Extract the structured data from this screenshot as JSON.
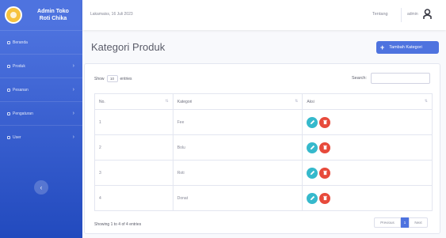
{
  "brand": {
    "line1": "Admin Toko",
    "line2": "Roti Chika"
  },
  "sidebar": {
    "items": [
      {
        "label": "Beranda",
        "has_chevron": false
      },
      {
        "label": "Produk",
        "has_chevron": true
      },
      {
        "label": "Pesanan",
        "has_chevron": true
      },
      {
        "label": "Pengaturan",
        "has_chevron": true
      },
      {
        "label": "User",
        "has_chevron": true
      }
    ],
    "toggle_icon": "chevron-left-icon"
  },
  "topbar": {
    "date": "Lakamaiss, 16 Juli 2023",
    "link": "Tentang",
    "user": "admin",
    "user_icon": "user-icon"
  },
  "page": {
    "title": "Kategori Produk",
    "add_button": "Tambah Kategori"
  },
  "table_controls": {
    "show_label": "Show",
    "entries_value": "10",
    "entries_label": "entries",
    "search_label": "Search:"
  },
  "table": {
    "headers": [
      "No.",
      "Kategori",
      "Aksi"
    ],
    "rows": [
      {
        "no": "1",
        "kategori": "Fee"
      },
      {
        "no": "2",
        "kategori": "Bolu"
      },
      {
        "no": "3",
        "kategori": "Roti"
      },
      {
        "no": "4",
        "kategori": "Donat"
      }
    ]
  },
  "footer": {
    "info": "Showing 1 to 4 of 4 entries",
    "prev": "Previous",
    "page": "1",
    "next": "Next"
  },
  "colors": {
    "primary": "#4e73df",
    "info": "#36b9cc",
    "danger": "#e74a3b"
  }
}
